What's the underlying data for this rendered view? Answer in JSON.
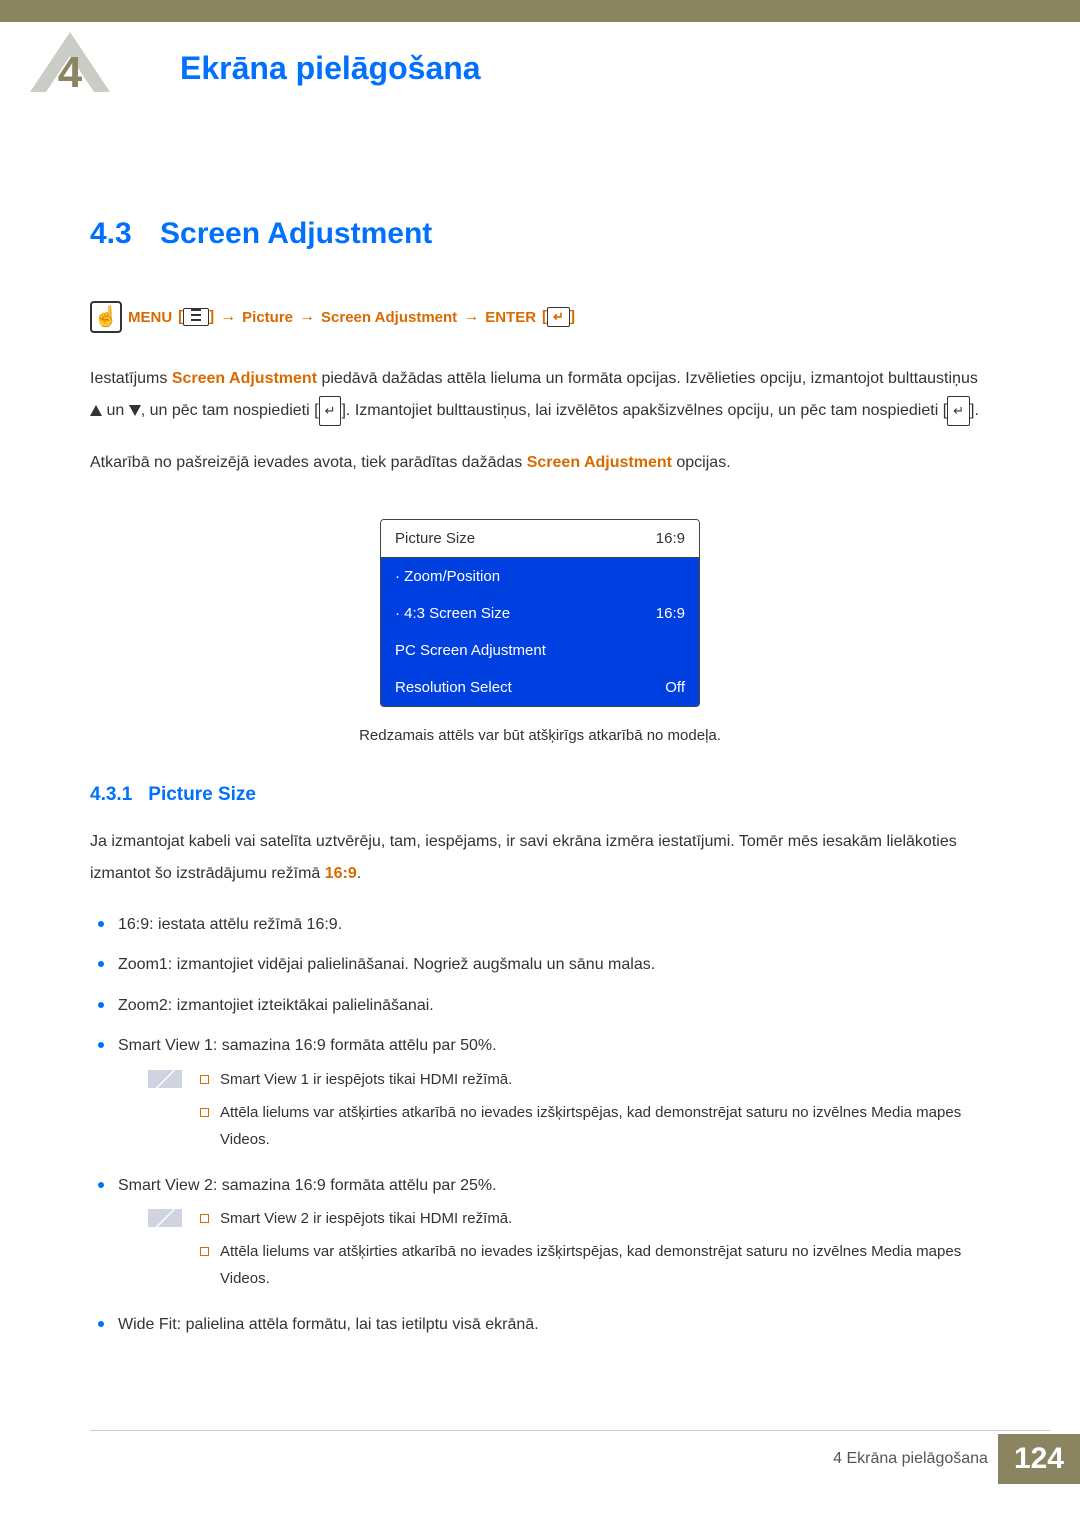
{
  "header": {
    "title": "Ekrāna pielāgošana"
  },
  "section": {
    "number": "4.3",
    "title": "Screen Adjustment"
  },
  "menuPath": {
    "menu": "MENU",
    "arrow": "→",
    "step1": "Picture",
    "step2": "Screen Adjustment",
    "enter": "ENTER"
  },
  "para1": {
    "a": "Iestatījums ",
    "b": "Screen Adjustment",
    "c": " piedāvā dažādas attēla lieluma un formāta opcijas. Izvēlieties opciju, izmantojot bulttaustiņus ",
    "d": " un ",
    "e": ", un pēc tam nospiedieti [",
    "f": "]. Izmantojiet bulttaustiņus, lai izvēlētos apakšizvēlnes opciju, un pēc tam nospiedieti [",
    "g": "]."
  },
  "para2": {
    "a": "Atkarībā no pašreizējā ievades avota, tiek parādītas dažādas ",
    "b": "Screen Adjustment",
    "c": " opcijas."
  },
  "menuTable": {
    "row1": {
      "label": "Picture Size",
      "value": "16:9"
    },
    "row2": {
      "label": "· Zoom/Position",
      "value": ""
    },
    "row3": {
      "label": "· 4:3 Screen Size",
      "value": "16:9"
    },
    "row4": {
      "label": "PC Screen Adjustment",
      "value": ""
    },
    "row5": {
      "label": "Resolution Select",
      "value": "Off"
    }
  },
  "menuNote": "Redzamais attēls var būt atšķirīgs atkarībā no modeļa.",
  "subsection": {
    "number": "4.3.1",
    "title": "Picture Size"
  },
  "subPara": {
    "a": "Ja izmantojat kabeli vai satelīta uztvērēju, tam, iespējams, ir savi ekrāna izmēra iestatījumi. Tomēr mēs iesakām lielākoties izmantot šo izstrādājumu režīmā ",
    "b": "16:9",
    "c": "."
  },
  "bullets": {
    "b1": {
      "k": "16:9",
      "t": ": iestata attēlu režīmā 16:9."
    },
    "b2": {
      "k": "Zoom1",
      "t": ": izmantojiet vidējai palielināšanai. Nogriež augšmalu un sānu malas."
    },
    "b3": {
      "k": "Zoom2",
      "t": ": izmantojiet izteiktākai palielināšanai."
    },
    "b4": {
      "k": "Smart View 1",
      "t": ": samazina 16:9 formāta attēlu par 50%."
    },
    "b5": {
      "k": "Smart View 2",
      "t": ": samazina 16:9 formāta attēlu par 25%."
    },
    "b6": {
      "k": "Wide Fit",
      "t": ": palielina attēla formātu, lai tas ietilptu visā ekrānā."
    }
  },
  "note1": {
    "s1": {
      "a": "Smart View 1",
      "b": " ir iespējots tikai ",
      "c": "HDMI",
      "d": " režīmā."
    },
    "s2": {
      "a": "Attēla lielums var atšķirties atkarībā no ievades izšķirtspējas, kad demonstrējat saturu no izvēlnes ",
      "b": "Media",
      "c": " mapes ",
      "d": "Videos",
      "e": "."
    }
  },
  "note2": {
    "s1": {
      "a": "Smart View 2",
      "b": " ir iespējots tikai ",
      "c": "HDMI",
      "d": " režīmā."
    },
    "s2": {
      "a": "Attēla lielums var atšķirties atkarībā no ievades izšķirtspējas, kad demonstrējat saturu no izvēlnes ",
      "b": "Media",
      "c": " mapes ",
      "d": "Videos",
      "e": "."
    }
  },
  "footer": {
    "label": "4 Ekrāna pielāgošana",
    "page": "124"
  }
}
